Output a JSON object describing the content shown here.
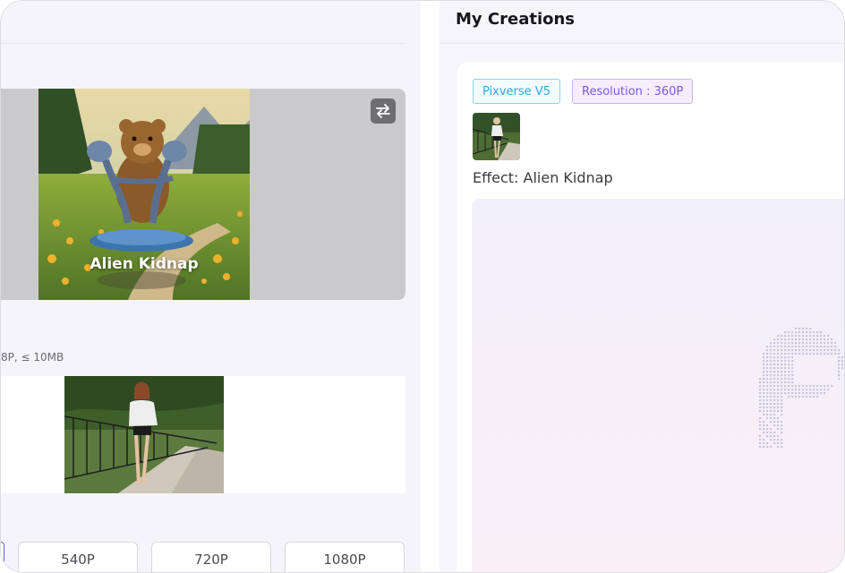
{
  "left_panel": {
    "effect": {
      "name": "Alien Kidnap"
    },
    "upload": {
      "hint": "8P, ≤ 10MB"
    },
    "resolution_options": [
      "540P",
      "720P",
      "1080P"
    ]
  },
  "right_panel": {
    "title": "My Creations",
    "creation": {
      "model_tag": "Pixverse V5",
      "resolution_tag": "Resolution : 360P",
      "effect_text": "Effect: Alien Kidnap"
    }
  },
  "colors": {
    "accent": "#6a5cf0",
    "model_tag": "#2ea9dc",
    "resolution_tag": "#7a58dd"
  },
  "icons": [
    "swap-icon",
    "loading-dots-icon"
  ]
}
